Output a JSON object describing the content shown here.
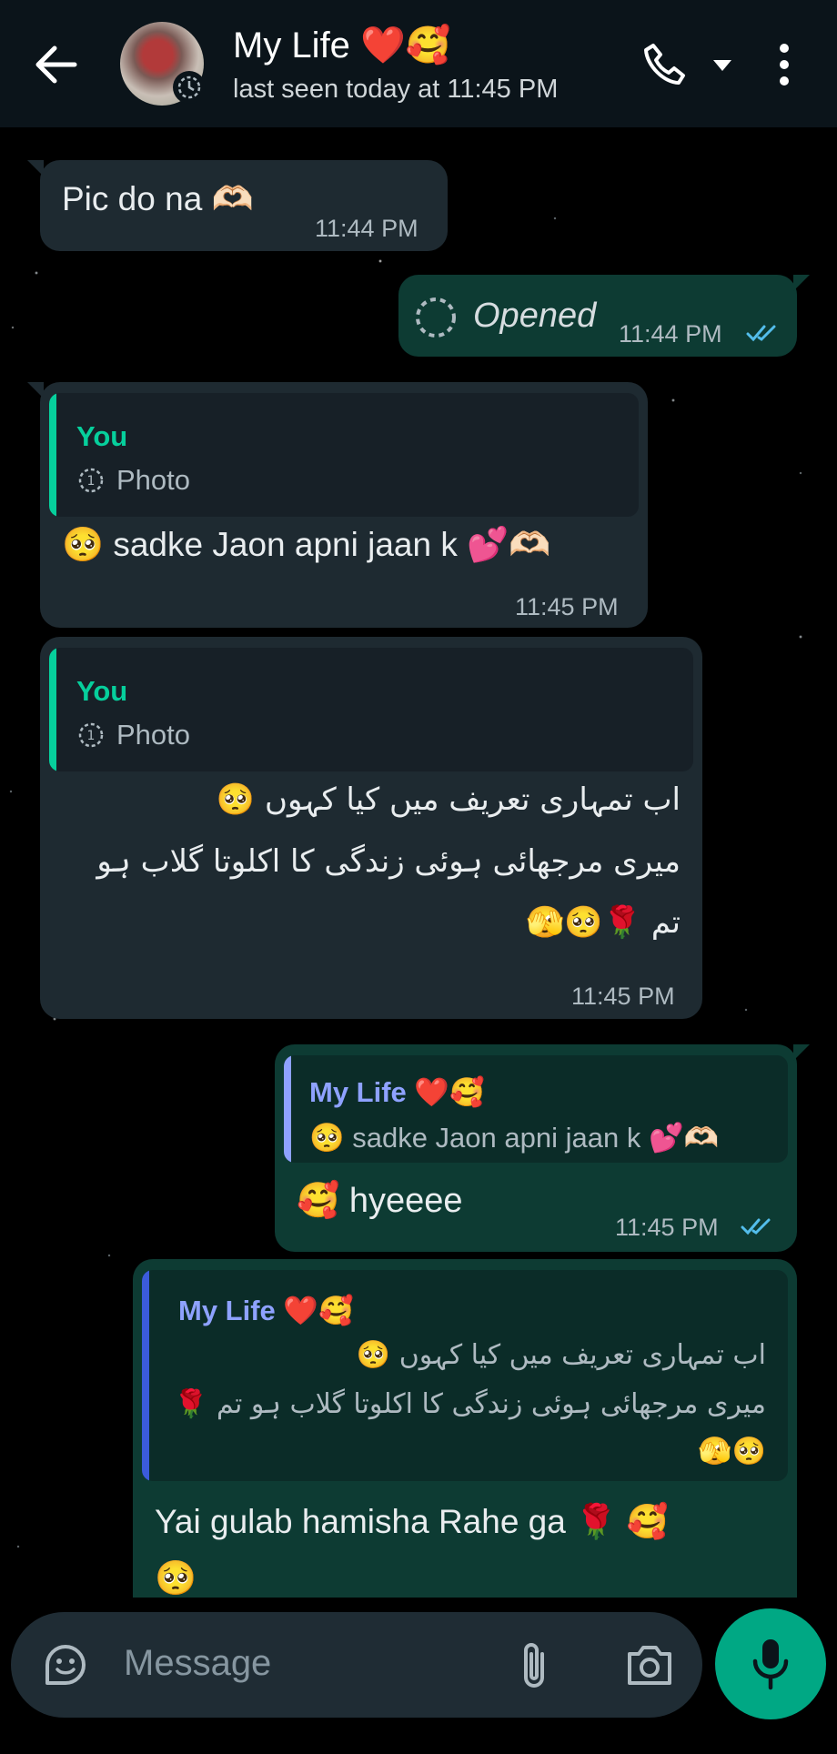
{
  "header": {
    "contact_name": "My Life ❤️🥰",
    "last_seen": "last seen today at 11:45 PM",
    "icons": [
      "back-arrow-icon",
      "avatar",
      "call-icon",
      "dropdown-caret-icon",
      "more-options-icon"
    ]
  },
  "messages": [
    {
      "direction": "incoming",
      "text": "Pic do na 🫶🏻",
      "time": "11:44 PM"
    },
    {
      "direction": "outgoing",
      "text": "Opened",
      "type": "view-once-photo",
      "time": "11:44 PM",
      "status": "read"
    },
    {
      "direction": "incoming",
      "quote_name": "You",
      "quote_text": "Photo",
      "text": "🥺 sadke Jaon apni jaan k 💕🫶🏻",
      "time": "11:45 PM"
    },
    {
      "direction": "incoming",
      "quote_name": "You",
      "quote_text": "Photo",
      "lines": [
        "اب تمہاری تعریف میں کیا کہوں 🥺",
        "میری مرجھائی ہوئی زندگی کا اکلوتا گلاب ہو",
        "تم 🌹🥺🫣"
      ],
      "time": "11:45 PM"
    },
    {
      "direction": "outgoing",
      "quote_name": "My Life ❤️🥰",
      "quote_text": "🥺 sadke Jaon apni jaan k 💕🫶🏻",
      "text": "🥰 hyeeee",
      "time": "11:45 PM",
      "status": "read"
    },
    {
      "direction": "outgoing",
      "quote_name": "My Life ❤️🥰",
      "quote_lines": [
        "اب تمہاری تعریف میں کیا کہوں 🥺",
        "میری مرجھائی ہوئی زندگی کا اکلوتا گلاب ہو تم 🌹",
        "🥺🫣"
      ],
      "text": "Yai gulab hamisha Rahe ga 🌹 🥰",
      "text2": "🥺"
    }
  ],
  "input": {
    "placeholder": "Message"
  },
  "colors": {
    "incoming": "#1e2a31",
    "outgoing": "#0d3b33",
    "accent": "#00a884",
    "you_name": "#53bdeb",
    "mylife_name": "#8ea2ff"
  }
}
